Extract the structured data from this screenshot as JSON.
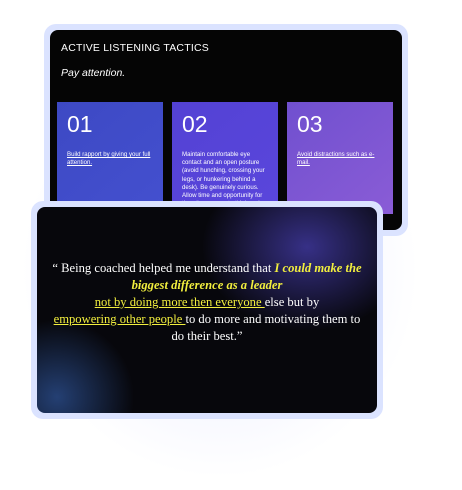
{
  "slide_top": {
    "title": "ACTIVE LISTENING TACTICS",
    "subtitle": "Pay attention.",
    "tiles": [
      {
        "number": "01",
        "text": "Build rapport by giving your full attention."
      },
      {
        "number": "02",
        "text": "Maintain comfortable eye contact and an open posture (avoid hunching, crossing your legs, or hunkering behind a desk). Be genuinely curious. Allow time and opportunity for the other person to think and speak."
      },
      {
        "number": "03",
        "text": "Avoid distractions such as e-mail."
      }
    ]
  },
  "slide_quote": {
    "open": "“ Being coached helped me understand that ",
    "highlight": "I could make the biggest difference as a leader",
    "underline1": "not by doing more then everyone ",
    "middle": "else but by ",
    "underline2": "empowering other people ",
    "end": "to do more and motivating them to do their best.”"
  },
  "colors": {
    "background": "#ffffff",
    "frame": "#dbe3ff",
    "slide": "#050505",
    "tile1": "#4450cf",
    "tile2": "#5a46dc",
    "tile3": "#8a5cd6",
    "highlight": "#f2ef3e"
  }
}
